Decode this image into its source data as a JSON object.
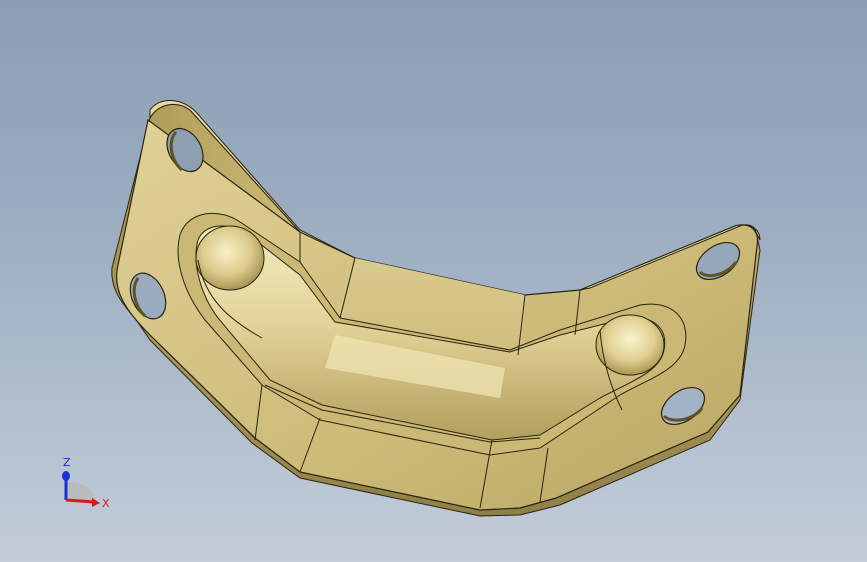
{
  "viewport": {
    "background_top": "#8a9db3",
    "background_bottom": "#c3cdd9"
  },
  "model": {
    "name": "bracket-part",
    "face_color": "#d8c88a",
    "edge_color": "#2a2410",
    "highlight_color": "#f2e8b8",
    "shadow_color": "#8f7f48"
  },
  "triad": {
    "z_label": "Z",
    "x_label": "X",
    "z_color": "#1a2fd6",
    "x_color": "#d61a1a"
  }
}
